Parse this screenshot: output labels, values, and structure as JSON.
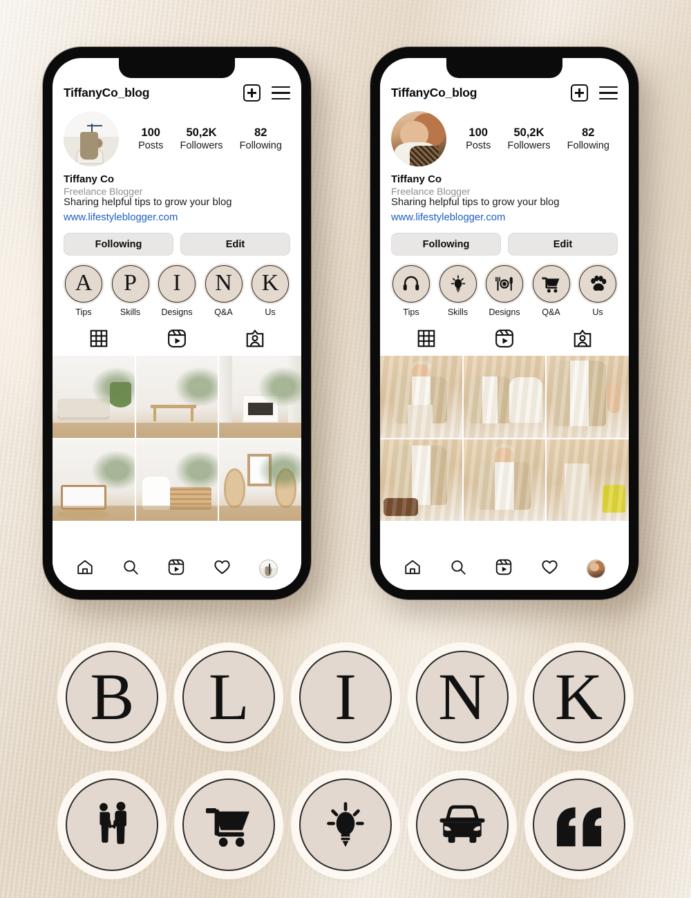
{
  "background": {
    "base_color": "#ece2d4",
    "accent_color": "#e3d8cf"
  },
  "phones": [
    {
      "id": "phone-left",
      "header": {
        "username": "TiffanyCo_blog",
        "add_icon": "plus-box-icon",
        "menu_icon": "hamburger-menu-icon"
      },
      "avatar_name": "profile-avatar",
      "stats": [
        {
          "num": "100",
          "label": "Posts"
        },
        {
          "num": "50,2K",
          "label": "Followers"
        },
        {
          "num": "82",
          "label": "Following"
        }
      ],
      "bio": {
        "name": "Tiffany Co",
        "role": "Freelance Blogger",
        "description": "Sharing helpful tips to grow your blog",
        "link": "www.lifestyleblogger.com",
        "link_color": "#1d5fc4"
      },
      "actions": [
        {
          "label": "Following"
        },
        {
          "label": "Edit"
        }
      ],
      "highlights": [
        {
          "type": "letter",
          "glyph": "A",
          "label": "Tips"
        },
        {
          "type": "letter",
          "glyph": "P",
          "label": "Skills"
        },
        {
          "type": "letter",
          "glyph": "I",
          "label": "Designs"
        },
        {
          "type": "letter",
          "glyph": "N",
          "label": "Q&A"
        },
        {
          "type": "letter",
          "glyph": "K",
          "label": "Us"
        }
      ],
      "tabs": [
        {
          "icon": "grid-icon"
        },
        {
          "icon": "reels-icon"
        },
        {
          "icon": "tagged-icon"
        }
      ],
      "grid_theme": "interior",
      "grid_cells": [
        "living-room-with-plant",
        "console-table-hallway",
        "fireplace-rattan-chairs",
        "wooden-bench-white-wall",
        "armchair-sideboard-lamp",
        "hanging-egg-chairs"
      ],
      "bottom_nav": [
        {
          "icon": "home-icon"
        },
        {
          "icon": "search-icon"
        },
        {
          "icon": "reels-icon"
        },
        {
          "icon": "heart-icon"
        },
        {
          "icon": "profile-avatar-icon"
        }
      ]
    },
    {
      "id": "phone-right",
      "header": {
        "username": "TiffanyCo_blog",
        "add_icon": "plus-box-icon",
        "menu_icon": "hamburger-menu-icon"
      },
      "avatar_name": "profile-avatar",
      "stats": [
        {
          "num": "100",
          "label": "Posts"
        },
        {
          "num": "50,2K",
          "label": "Followers"
        },
        {
          "num": "82",
          "label": "Following"
        }
      ],
      "bio": {
        "name": "Tiffany Co",
        "role": "Freelance Blogger",
        "description": "Sharing helpful tips to grow your blog",
        "link": "www.lifestyleblogger.com",
        "link_color": "#1d5fc4"
      },
      "actions": [
        {
          "label": "Following"
        },
        {
          "label": "Edit"
        }
      ],
      "highlights": [
        {
          "type": "icon",
          "glyph": "headphones-icon",
          "label": "Tips"
        },
        {
          "type": "icon",
          "glyph": "lightbulb-icon",
          "label": "Skills"
        },
        {
          "type": "icon",
          "glyph": "plate-cutlery-icon",
          "label": "Designs"
        },
        {
          "type": "icon",
          "glyph": "shopping-cart-icon",
          "label": "Q&A"
        },
        {
          "type": "icon",
          "glyph": "paw-print-icon",
          "label": "Us"
        }
      ],
      "tabs": [
        {
          "icon": "grid-icon"
        },
        {
          "icon": "reels-icon"
        },
        {
          "icon": "tagged-icon"
        }
      ],
      "grid_theme": "fashion",
      "grid_cells": [
        "woman-seated-beige-suit",
        "two-women-cream-blazers",
        "hands-in-beige-pockets",
        "woman-leaning-on-case",
        "woman-standing-curtain",
        "legs-heels-yellow-chair"
      ],
      "bottom_nav": [
        {
          "icon": "home-icon"
        },
        {
          "icon": "search-icon"
        },
        {
          "icon": "reels-icon"
        },
        {
          "icon": "heart-icon"
        },
        {
          "icon": "profile-avatar-icon"
        }
      ]
    }
  ],
  "stickers": [
    {
      "type": "letter",
      "glyph": "B",
      "name": "sticker-letter-b"
    },
    {
      "type": "letter",
      "glyph": "L",
      "name": "sticker-letter-l"
    },
    {
      "type": "letter",
      "glyph": "I",
      "name": "sticker-letter-i"
    },
    {
      "type": "letter",
      "glyph": "N",
      "name": "sticker-letter-n"
    },
    {
      "type": "letter",
      "glyph": "K",
      "name": "sticker-letter-k"
    },
    {
      "type": "icon",
      "glyph": "couple-holding-hands-icon",
      "name": "sticker-couple"
    },
    {
      "type": "icon",
      "glyph": "shopping-cart-icon",
      "name": "sticker-cart"
    },
    {
      "type": "icon",
      "glyph": "lightbulb-icon",
      "name": "sticker-lightbulb"
    },
    {
      "type": "icon",
      "glyph": "car-icon",
      "name": "sticker-car"
    },
    {
      "type": "icon",
      "glyph": "quotation-marks-icon",
      "name": "sticker-quote"
    }
  ]
}
